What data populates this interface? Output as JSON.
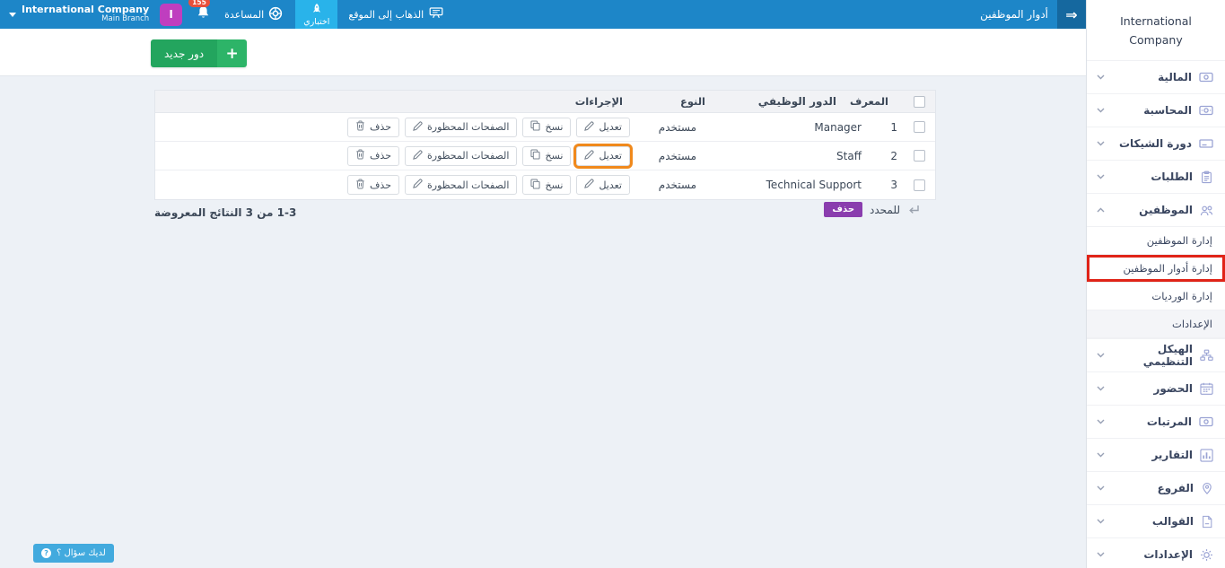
{
  "topbar": {
    "company": "International Company",
    "branch": "Main Branch",
    "avatar_letter": "I",
    "notification_count": "155",
    "help_label": "المساعدة",
    "trial_label": "اختباري",
    "go_to_site_label": "الذهاب إلى الموقع",
    "page_title": "أدوار الموظفين"
  },
  "icons": {
    "plus": "+",
    "double_arrow": "⇒",
    "question": "?"
  },
  "sidebar": {
    "company_name": "International Company",
    "items": [
      {
        "label": "المالية",
        "icon": "banknote-icon"
      },
      {
        "label": "المحاسبة",
        "icon": "cash-icon"
      },
      {
        "label": "دورة الشيكات",
        "icon": "cheque-icon"
      },
      {
        "label": "الطلبات",
        "icon": "clipboard-icon"
      },
      {
        "label": "الموظفين",
        "icon": "people-icon",
        "expanded": true
      },
      {
        "label": "الهيكل التنظيمي",
        "icon": "sitemap-icon"
      },
      {
        "label": "الحضور",
        "icon": "calendar-icon"
      },
      {
        "label": "المرتبات",
        "icon": "money-icon"
      },
      {
        "label": "التقارير",
        "icon": "bar-chart-icon"
      },
      {
        "label": "الفروع",
        "icon": "map-pin-icon"
      },
      {
        "label": "القوالب",
        "icon": "document-icon"
      },
      {
        "label": "الإعدادات",
        "icon": "gear-icon"
      }
    ],
    "employees_submenu": [
      {
        "label": "إدارة الموظفين"
      },
      {
        "label": "إدارة أدوار الموظفين",
        "highlighted": true
      },
      {
        "label": "إدارة الورديات"
      },
      {
        "label": "الإعدادات"
      }
    ]
  },
  "main": {
    "new_role_button": "دور جديد",
    "table": {
      "headers": [
        "المعرف",
        "الدور الوظيفي",
        "النوع",
        "الإجراءات"
      ],
      "rows": [
        {
          "id": "1",
          "role": "Manager",
          "type": "مستخدم"
        },
        {
          "id": "2",
          "role": "Staff",
          "type": "مستخدم",
          "edit_highlighted": true
        },
        {
          "id": "3",
          "role": "Technical Support",
          "type": "مستخدم"
        }
      ],
      "action_labels": {
        "edit": "تعديل",
        "copy": "نسخ",
        "banned_pages": "الصفحات المحظورة",
        "delete": "حذف"
      }
    },
    "bulk": {
      "selected_label": "للمحدد",
      "delete_button": "حذف"
    },
    "pagination": "1-3 من 3 النتائج المعروضة",
    "help_button": "لديك سؤال ؟"
  },
  "colors": {
    "topbar_blue": "#1d86c8",
    "toggle_blue": "#15689f",
    "trial_light_blue": "#29b3ea",
    "green_primary": "#23a55e",
    "green_plus": "#2db468",
    "purple_delete": "#8a3dae",
    "magenta_avatar": "#bf3ebf",
    "badge_red": "#e8503c",
    "help_blue": "#42aade",
    "highlight_orange": "#f0891c",
    "highlight_red": "#e02418",
    "sidebar_icon_purple": "#9aa3d4",
    "text_dark": "#3c4858",
    "content_bg": "#edf1f6"
  }
}
